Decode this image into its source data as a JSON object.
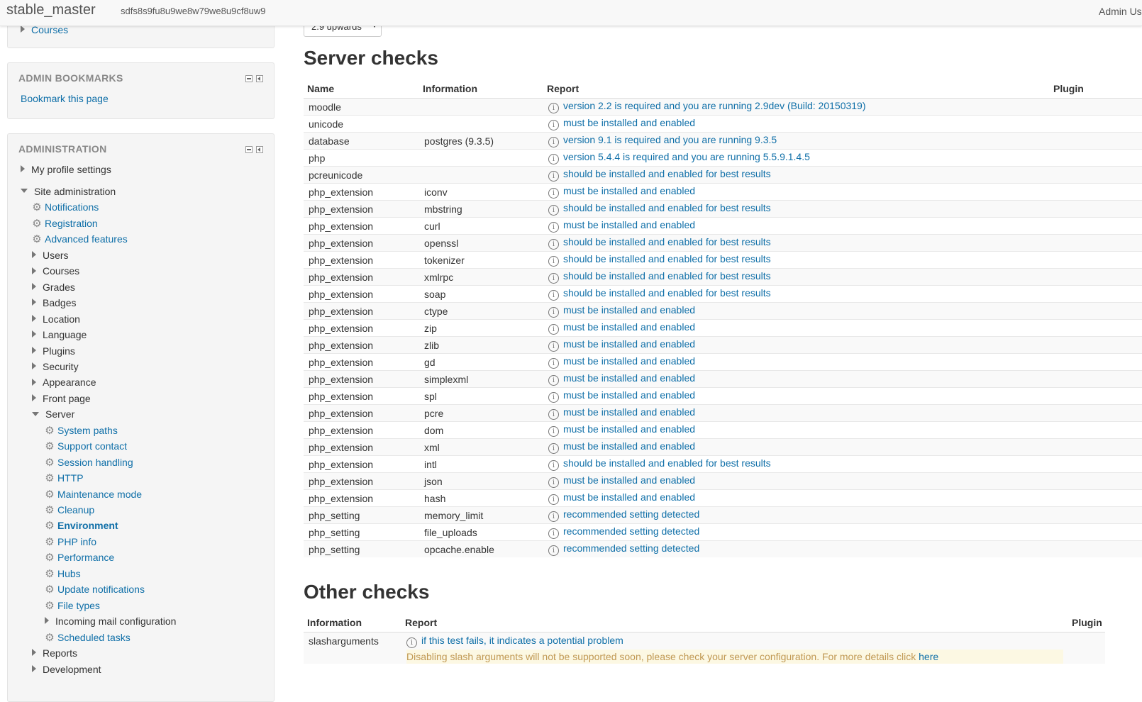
{
  "navbar": {
    "site_name": "stable_master",
    "wwwroot": "sdfs8s9fu8u9we8w79we8u9cf8uw9",
    "user_menu": "Admin Us"
  },
  "navigation_block": {
    "courses_label": "Courses"
  },
  "bookmarks_block": {
    "title": "ADMIN BOOKMARKS",
    "bookmark_link": "Bookmark this page"
  },
  "admin_block": {
    "title": "ADMINISTRATION",
    "my_profile": "My profile settings",
    "site_admin": "Site administration",
    "site_items": [
      {
        "label": "Notifications",
        "type": "gear"
      },
      {
        "label": "Registration",
        "type": "gear"
      },
      {
        "label": "Advanced features",
        "type": "gear"
      },
      {
        "label": "Users",
        "type": "folder"
      },
      {
        "label": "Courses",
        "type": "folder"
      },
      {
        "label": "Grades",
        "type": "folder"
      },
      {
        "label": "Badges",
        "type": "folder"
      },
      {
        "label": "Location",
        "type": "folder"
      },
      {
        "label": "Language",
        "type": "folder"
      },
      {
        "label": "Plugins",
        "type": "folder"
      },
      {
        "label": "Security",
        "type": "folder"
      },
      {
        "label": "Appearance",
        "type": "folder"
      },
      {
        "label": "Front page",
        "type": "folder"
      },
      {
        "label": "Server",
        "type": "open-folder"
      }
    ],
    "server_items": [
      {
        "label": "System paths",
        "type": "gear"
      },
      {
        "label": "Support contact",
        "type": "gear"
      },
      {
        "label": "Session handling",
        "type": "gear"
      },
      {
        "label": "HTTP",
        "type": "gear"
      },
      {
        "label": "Maintenance mode",
        "type": "gear"
      },
      {
        "label": "Cleanup",
        "type": "gear"
      },
      {
        "label": "Environment",
        "type": "gear-active"
      },
      {
        "label": "PHP info",
        "type": "gear"
      },
      {
        "label": "Performance",
        "type": "gear"
      },
      {
        "label": "Hubs",
        "type": "gear"
      },
      {
        "label": "Update notifications",
        "type": "gear"
      },
      {
        "label": "File types",
        "type": "gear"
      },
      {
        "label": "Incoming mail configuration",
        "type": "folder"
      },
      {
        "label": "Scheduled tasks",
        "type": "gear"
      }
    ],
    "after_items": [
      {
        "label": "Reports",
        "type": "folder"
      },
      {
        "label": "Development",
        "type": "folder"
      }
    ]
  },
  "version_select": {
    "value": "2.9 upwards"
  },
  "server_checks": {
    "title": "Server checks",
    "columns": [
      "Name",
      "Information",
      "Report",
      "Plugin"
    ],
    "rows": [
      [
        "moodle",
        "",
        "version 2.2 is required and you are running 2.9dev (Build: 20150319)"
      ],
      [
        "unicode",
        "",
        "must be installed and enabled"
      ],
      [
        "database",
        "postgres (9.3.5)",
        "version 9.1 is required and you are running 9.3.5"
      ],
      [
        "php",
        "",
        "version 5.4.4 is required and you are running 5.5.9.1.4.5"
      ],
      [
        "pcreunicode",
        "",
        "should be installed and enabled for best results"
      ],
      [
        "php_extension",
        "iconv",
        "must be installed and enabled"
      ],
      [
        "php_extension",
        "mbstring",
        "should be installed and enabled for best results"
      ],
      [
        "php_extension",
        "curl",
        "must be installed and enabled"
      ],
      [
        "php_extension",
        "openssl",
        "should be installed and enabled for best results"
      ],
      [
        "php_extension",
        "tokenizer",
        "should be installed and enabled for best results"
      ],
      [
        "php_extension",
        "xmlrpc",
        "should be installed and enabled for best results"
      ],
      [
        "php_extension",
        "soap",
        "should be installed and enabled for best results"
      ],
      [
        "php_extension",
        "ctype",
        "must be installed and enabled"
      ],
      [
        "php_extension",
        "zip",
        "must be installed and enabled"
      ],
      [
        "php_extension",
        "zlib",
        "must be installed and enabled"
      ],
      [
        "php_extension",
        "gd",
        "must be installed and enabled"
      ],
      [
        "php_extension",
        "simplexml",
        "must be installed and enabled"
      ],
      [
        "php_extension",
        "spl",
        "must be installed and enabled"
      ],
      [
        "php_extension",
        "pcre",
        "must be installed and enabled"
      ],
      [
        "php_extension",
        "dom",
        "must be installed and enabled"
      ],
      [
        "php_extension",
        "xml",
        "must be installed and enabled"
      ],
      [
        "php_extension",
        "intl",
        "should be installed and enabled for best results"
      ],
      [
        "php_extension",
        "json",
        "must be installed and enabled"
      ],
      [
        "php_extension",
        "hash",
        "must be installed and enabled"
      ],
      [
        "php_setting",
        "memory_limit",
        "recommended setting detected"
      ],
      [
        "php_setting",
        "file_uploads",
        "recommended setting detected"
      ],
      [
        "php_setting",
        "opcache.enable",
        "recommended setting detected"
      ]
    ]
  },
  "other_checks": {
    "title": "Other checks",
    "columns": [
      "Information",
      "Report",
      "Plugin"
    ],
    "rows": [
      {
        "info": "slasharguments",
        "report": "if this test fails, it indicates a potential problem",
        "warning": "Disabling slash arguments will not be supported soon, please check your server configuration. For more details click ",
        "warning_link": "here"
      }
    ]
  }
}
